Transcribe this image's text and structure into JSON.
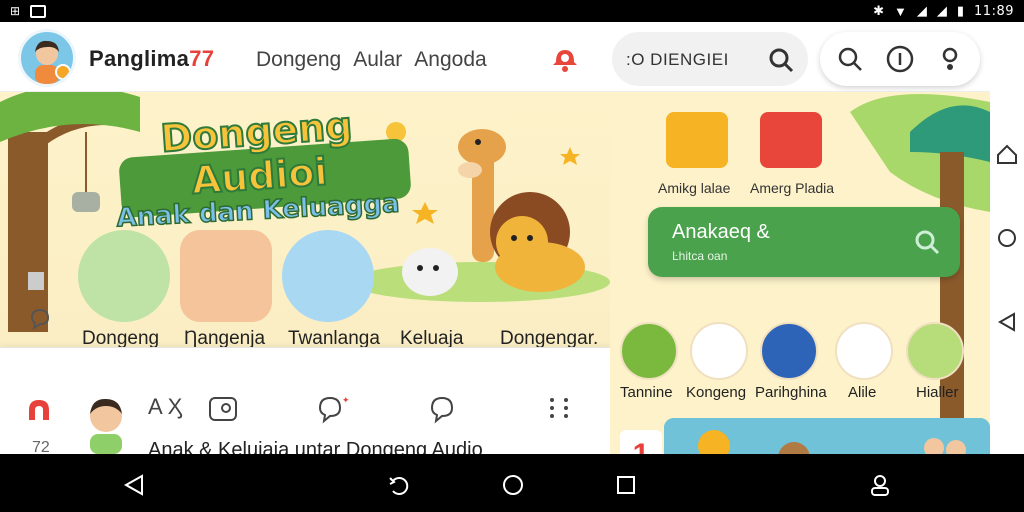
{
  "status_bar": {
    "clock": "11:89"
  },
  "header": {
    "brand": "Panglima",
    "brand_num": "77",
    "nav_items": [
      "Dongeng",
      "Aular",
      "Angoda"
    ],
    "search_text": ":O DIENGIEI"
  },
  "hero": {
    "title_line1": "Dongeng Audioi",
    "title_line2": "Anak dan Keluagga",
    "categories": [
      {
        "label": "Dongeng",
        "color": "#bfe3a6"
      },
      {
        "label": "Ƞangenja",
        "color": "#f5c49a"
      },
      {
        "label": "Twanlanga",
        "color": "#a8d8f2"
      },
      {
        "label": "Keluaja",
        "color": "#e9f0d8"
      },
      {
        "label": "Dongengar.",
        "color": "#f3c97b"
      }
    ]
  },
  "bottom_card": {
    "count": "72",
    "icon_text": "A Ӽ",
    "caption": "Anak & Kelujaja untar  Dongeng Audio"
  },
  "right_panel": {
    "tiles": [
      {
        "label": "Amikg lalae",
        "color": "#f6b324"
      },
      {
        "label": "Amerg Pladia",
        "color": "#e8463a"
      }
    ],
    "search_card": {
      "title": "Anakaeq &",
      "subtitle": "Ŀhitca oan"
    },
    "categories": [
      {
        "label": "Tannine",
        "color": "#7ab93d"
      },
      {
        "label": "Kongeng",
        "color": "#ffffff"
      },
      {
        "label": "Parihghina",
        "color": "#2d64b8"
      },
      {
        "label": "Alile",
        "color": "#ffffff"
      },
      {
        "label": "Hialler",
        "color": "#b7dc7a"
      }
    ],
    "rank_number": "1"
  }
}
